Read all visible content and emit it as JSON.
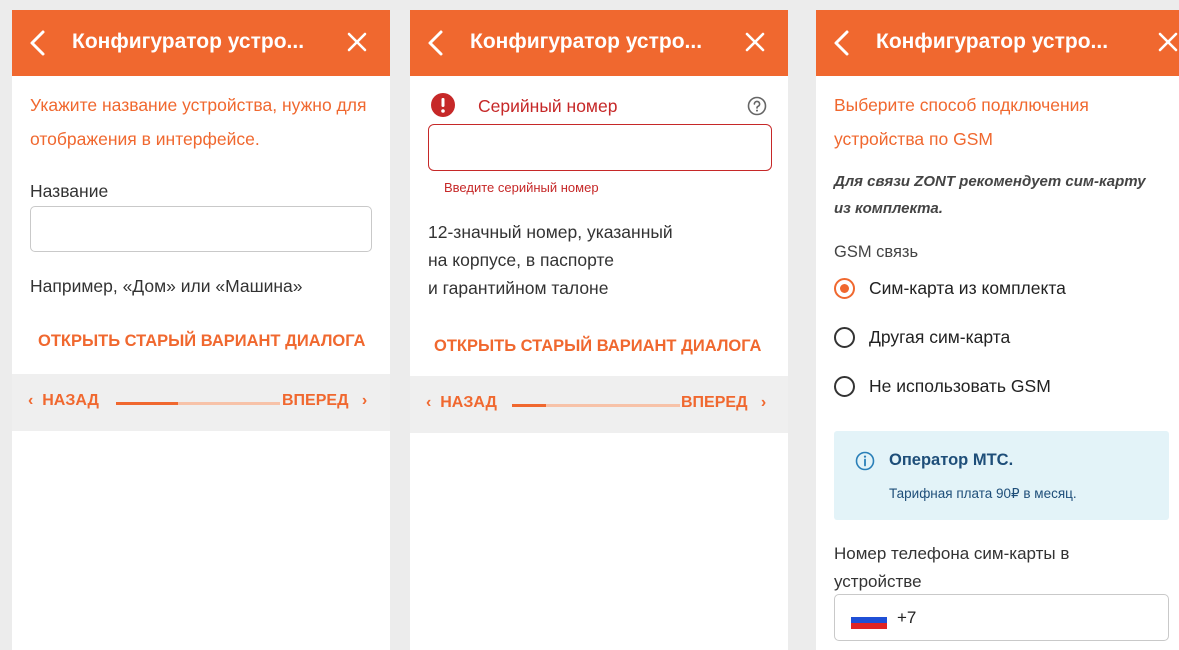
{
  "app": {
    "title": "Конфигуратор устро...",
    "icons": {
      "back": "back-arrow-icon",
      "close": "close-icon",
      "error": "error-icon",
      "help": "help-icon",
      "info": "info-icon",
      "flag": "russia-flag-icon"
    },
    "colors": {
      "accent": "#f0682f",
      "error": "#c62828",
      "info_bg": "#e3f3f8",
      "info_text": "#1e4e79"
    }
  },
  "panel1": {
    "instruction": "Укажите название устройства, нужно для отображения в интерфейсе.",
    "name_label": "Название",
    "name_value": "",
    "hint": "Например, «Дом» или «Машина»",
    "old_dialog_link": "ОТКРЫТЬ СТАРЫЙ ВАРИАНТ ДИАЛОГА",
    "nav": {
      "back": "НАЗАД",
      "next": "ВПЕРЕД",
      "progress": 0.38
    }
  },
  "panel2": {
    "serial_label": "Серийный номер",
    "serial_value": "",
    "error_text": "Введите серийный номер",
    "description_lines": [
      "12-значный номер, указанный",
      "на корпусе, в паспорте",
      "и гарантийном талоне"
    ],
    "old_dialog_link": "ОТКРЫТЬ СТАРЫЙ ВАРИАНТ ДИАЛОГА",
    "nav": {
      "back": "НАЗАД",
      "next": "ВПЕРЕД",
      "progress": 0.2
    }
  },
  "panel3": {
    "heading_lines": [
      "Выберите способ подключения",
      "устройства по GSM"
    ],
    "recommendation_lines": [
      "Для связи ZONT рекомендует сим-карту",
      "из комплекта."
    ],
    "gsm_label": "GSM связь",
    "options": [
      {
        "label": "Сим-карта из комплекта",
        "selected": true
      },
      {
        "label": "Другая сим-карта",
        "selected": false
      },
      {
        "label": "Не использовать GSM",
        "selected": false
      }
    ],
    "info_title": "Оператор МТС.",
    "info_text": "Тарифная плата 90₽ в месяц.",
    "phone_label_lines": [
      "Номер телефона сим-карты в",
      "устройстве"
    ],
    "phone_prefix": "+7"
  }
}
